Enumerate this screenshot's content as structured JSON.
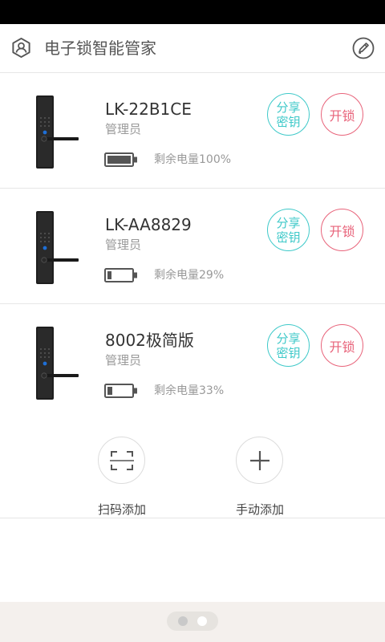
{
  "header": {
    "title": "电子锁智能管家",
    "left_icon": "user-shield-icon",
    "right_icon": "edit-pencil-icon"
  },
  "locks": [
    {
      "name": "LK-22B1CE",
      "role": "管理员",
      "battery_text": "剩余电量100%",
      "battery_level": 1.0,
      "share_label": "分享密钥",
      "unlock_label": "开锁"
    },
    {
      "name": "LK-AA8829",
      "role": "管理员",
      "battery_text": "剩余电量29%",
      "battery_level": 0.29,
      "share_label": "分享密钥",
      "unlock_label": "开锁"
    },
    {
      "name": "8002极简版",
      "role": "管理员",
      "battery_text": "剩余电量33%",
      "battery_level": 0.33,
      "share_label": "分享密钥",
      "unlock_label": "开锁"
    }
  ],
  "add": {
    "scan_label": "扫码添加",
    "manual_label": "手动添加"
  },
  "pager": {
    "count": 2,
    "active": 2
  },
  "colors": {
    "share": "#3ec9c9",
    "unlock": "#e8637a",
    "footer_bg": "#f4f0ed"
  }
}
